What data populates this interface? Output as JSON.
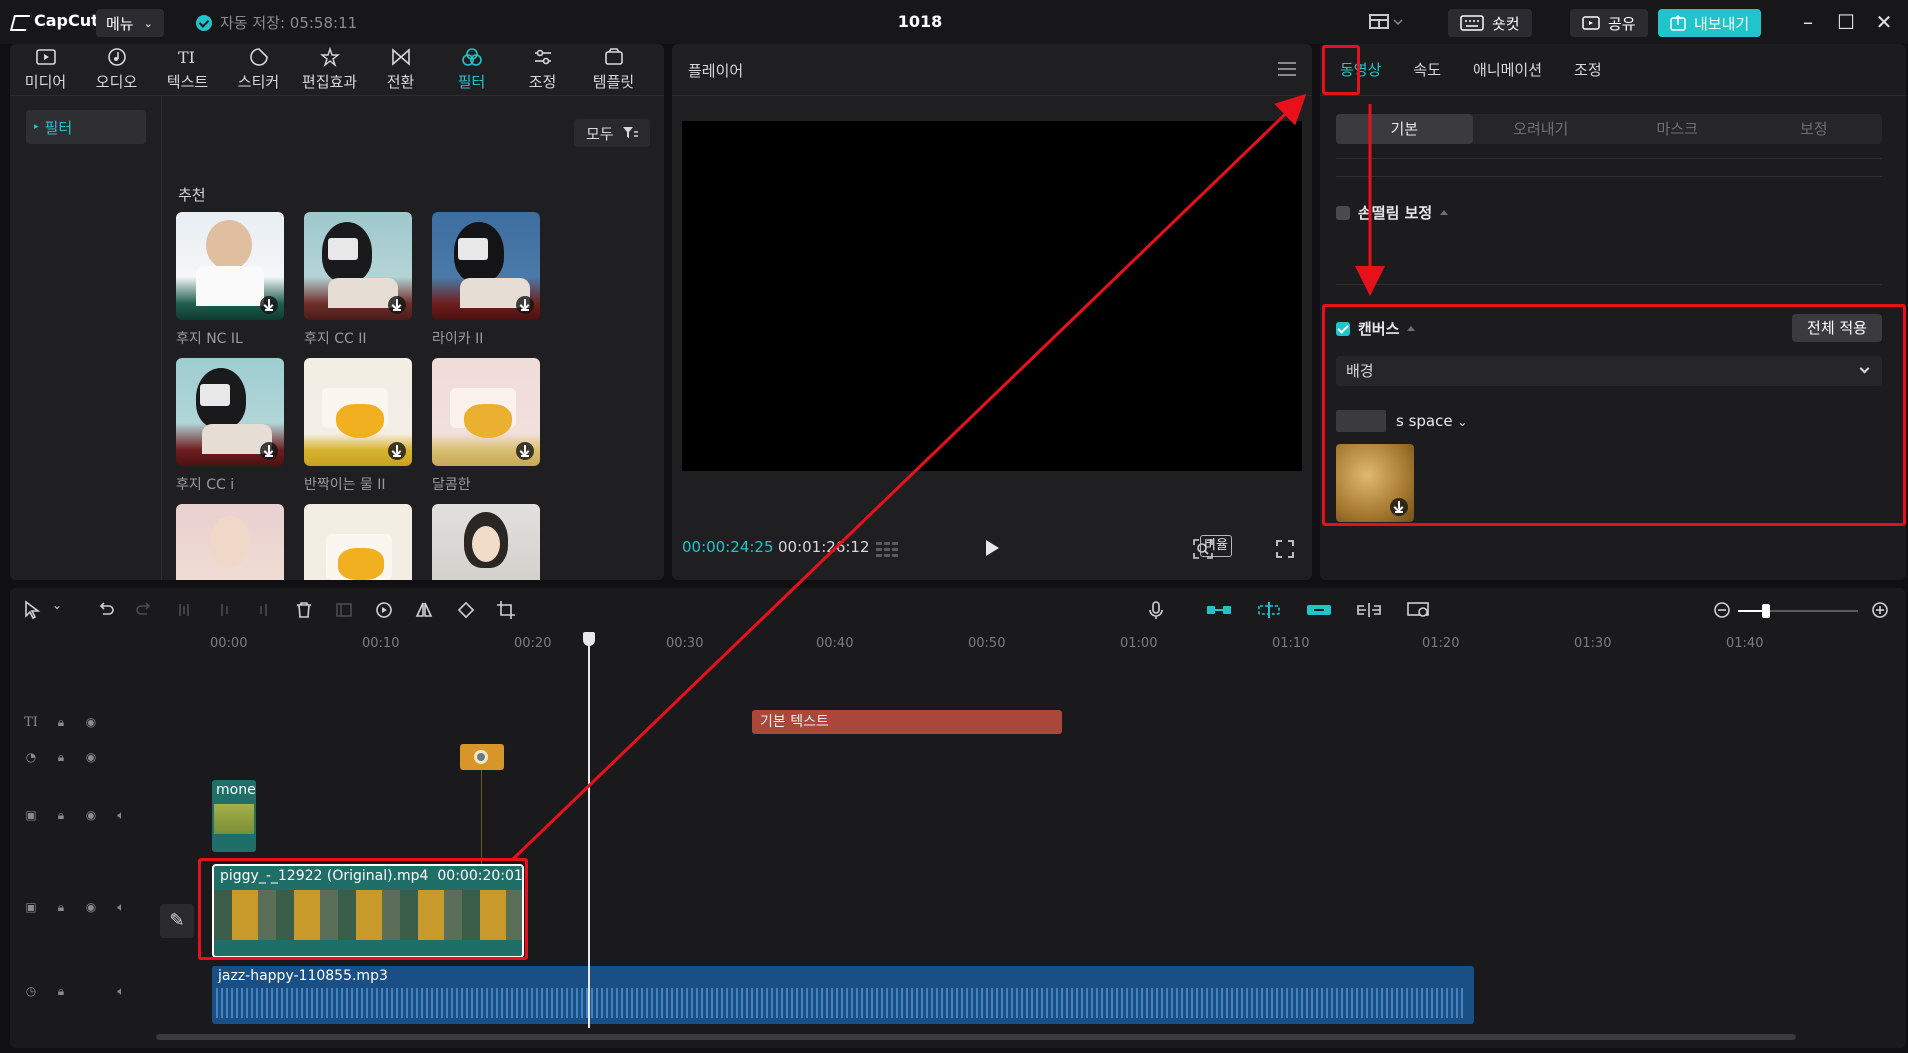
{
  "titlebar": {
    "app_name": "CapCut",
    "menu_label": "메뉴",
    "autosave": "자동 저장: 05:58:11",
    "project_title": "1018",
    "shortcut_label": "숏컷",
    "share_label": "공유",
    "export_label": "내보내기"
  },
  "left_panel": {
    "tools": [
      {
        "label": "미디어",
        "icon": "media-icon"
      },
      {
        "label": "오디오",
        "icon": "audio-icon"
      },
      {
        "label": "텍스트",
        "icon": "text-icon"
      },
      {
        "label": "스티커",
        "icon": "sticker-icon"
      },
      {
        "label": "편집효과",
        "icon": "effects-icon"
      },
      {
        "label": "전환",
        "icon": "transition-icon"
      },
      {
        "label": "필터",
        "icon": "filter-icon",
        "active": true
      },
      {
        "label": "조정",
        "icon": "adjust-icon"
      },
      {
        "label": "템플릿",
        "icon": "template-icon"
      }
    ],
    "side_item": "필터",
    "all_label": "모두",
    "section_title": "추천",
    "filters": [
      {
        "name": "후지 NC IL"
      },
      {
        "name": "후지 CC II"
      },
      {
        "name": "라이카 II"
      },
      {
        "name": "후지 CC i"
      },
      {
        "name": "반짝이는 물 II"
      },
      {
        "name": "달콤한"
      },
      {
        "name": ""
      },
      {
        "name": ""
      },
      {
        "name": ""
      }
    ]
  },
  "player": {
    "title": "플레이어",
    "current_time": "00:00:24:25",
    "total_time": "00:01:26:12",
    "ratio_label": "비율"
  },
  "right_panel": {
    "tabs": [
      "동영상",
      "속도",
      "애니메이션",
      "조정"
    ],
    "segments": [
      "기본",
      "오려내기",
      "마스크",
      "보정"
    ],
    "stabilize_label": "손떨림 보정",
    "canvas_label": "캔버스",
    "apply_all_label": "전체 적용",
    "background_select": "배경",
    "space_label": "s space"
  },
  "timeline": {
    "ruler": [
      "00:00",
      "00:10",
      "00:20",
      "00:30",
      "00:40",
      "00:50",
      "01:00",
      "01:10",
      "01:20",
      "01:30",
      "01:40"
    ],
    "text_clip": "기본 텍스트",
    "overlay_clip": "mone",
    "main_clip_name": "piggy_-_12922 (Original).mp4",
    "main_clip_duration": "00:00:20:01",
    "audio_clip": "jazz-happy-110855.mp3"
  },
  "colors": {
    "accent": "#20c4cb",
    "highlight": "#e8111b",
    "text_clip": "#a8473a",
    "sticker_clip": "#d8962a",
    "video_clip": "#1f6e68",
    "audio_clip": "#1a4f86"
  }
}
